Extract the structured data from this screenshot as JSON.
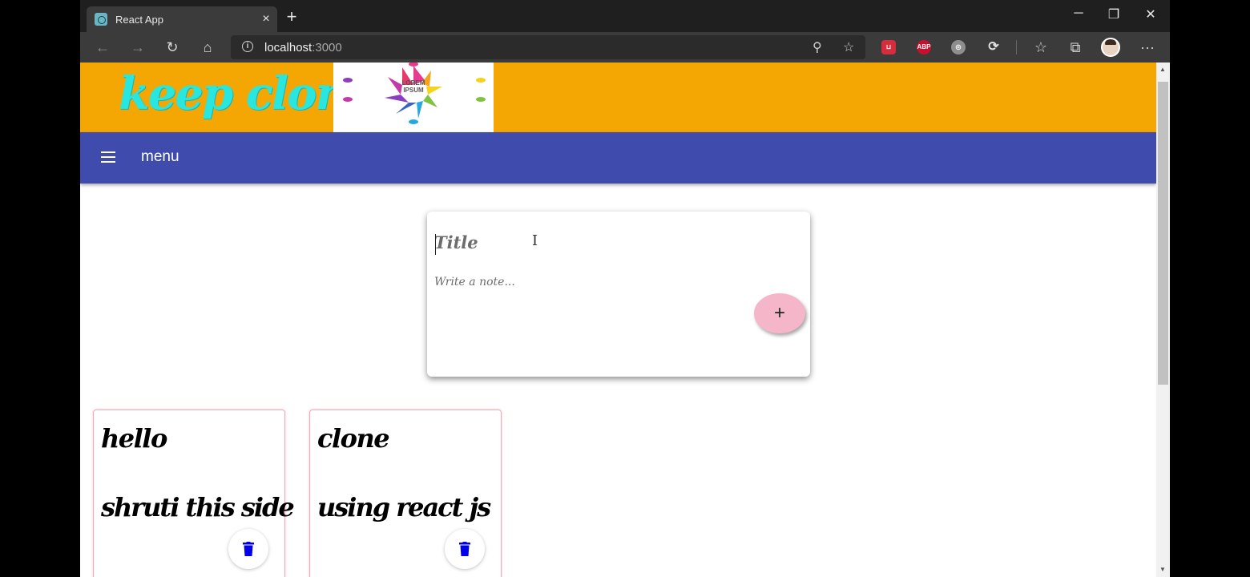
{
  "browser": {
    "tab_title": "React App",
    "tab_close_icon": "×",
    "new_tab_icon": "+",
    "window_minimize_icon": "─",
    "window_restore_icon": "❐",
    "window_close_icon": "✕",
    "back_icon": "←",
    "forward_icon": "→",
    "reload_icon": "↻",
    "home_icon": "⌂",
    "address_host": "localhost",
    "address_port": ":3000",
    "zoom_icon": "⚲",
    "favorite_icon": "☆",
    "favorites_icon": "☆",
    "collections_icon": "⧉",
    "more_icon": "···",
    "extensions": {
      "pocket": "⊔",
      "abp": "ABP",
      "ext3": "◎",
      "ext4": "⟳"
    }
  },
  "app": {
    "logo_text": "keep clone",
    "logo_image_text_line1": "LOREM",
    "logo_image_text_line2": "IPSUM",
    "menu_label": "menu",
    "form": {
      "title_placeholder": "Title",
      "note_placeholder": "Write a note...",
      "add_button_label": "+"
    },
    "notes": [
      {
        "title": "hello",
        "content": "shruti this side"
      },
      {
        "title": "clone",
        "content": "using react js"
      }
    ]
  },
  "scrollbar": {
    "up_icon": "▲",
    "down_icon": "▼"
  },
  "colors": {
    "banner": "#f4a703",
    "logo_text": "#29e6de",
    "menubar": "#3f4bad",
    "add_button": "#f4b6c8",
    "card_border": "#f2aabb",
    "trash_icon": "#0000ee"
  }
}
